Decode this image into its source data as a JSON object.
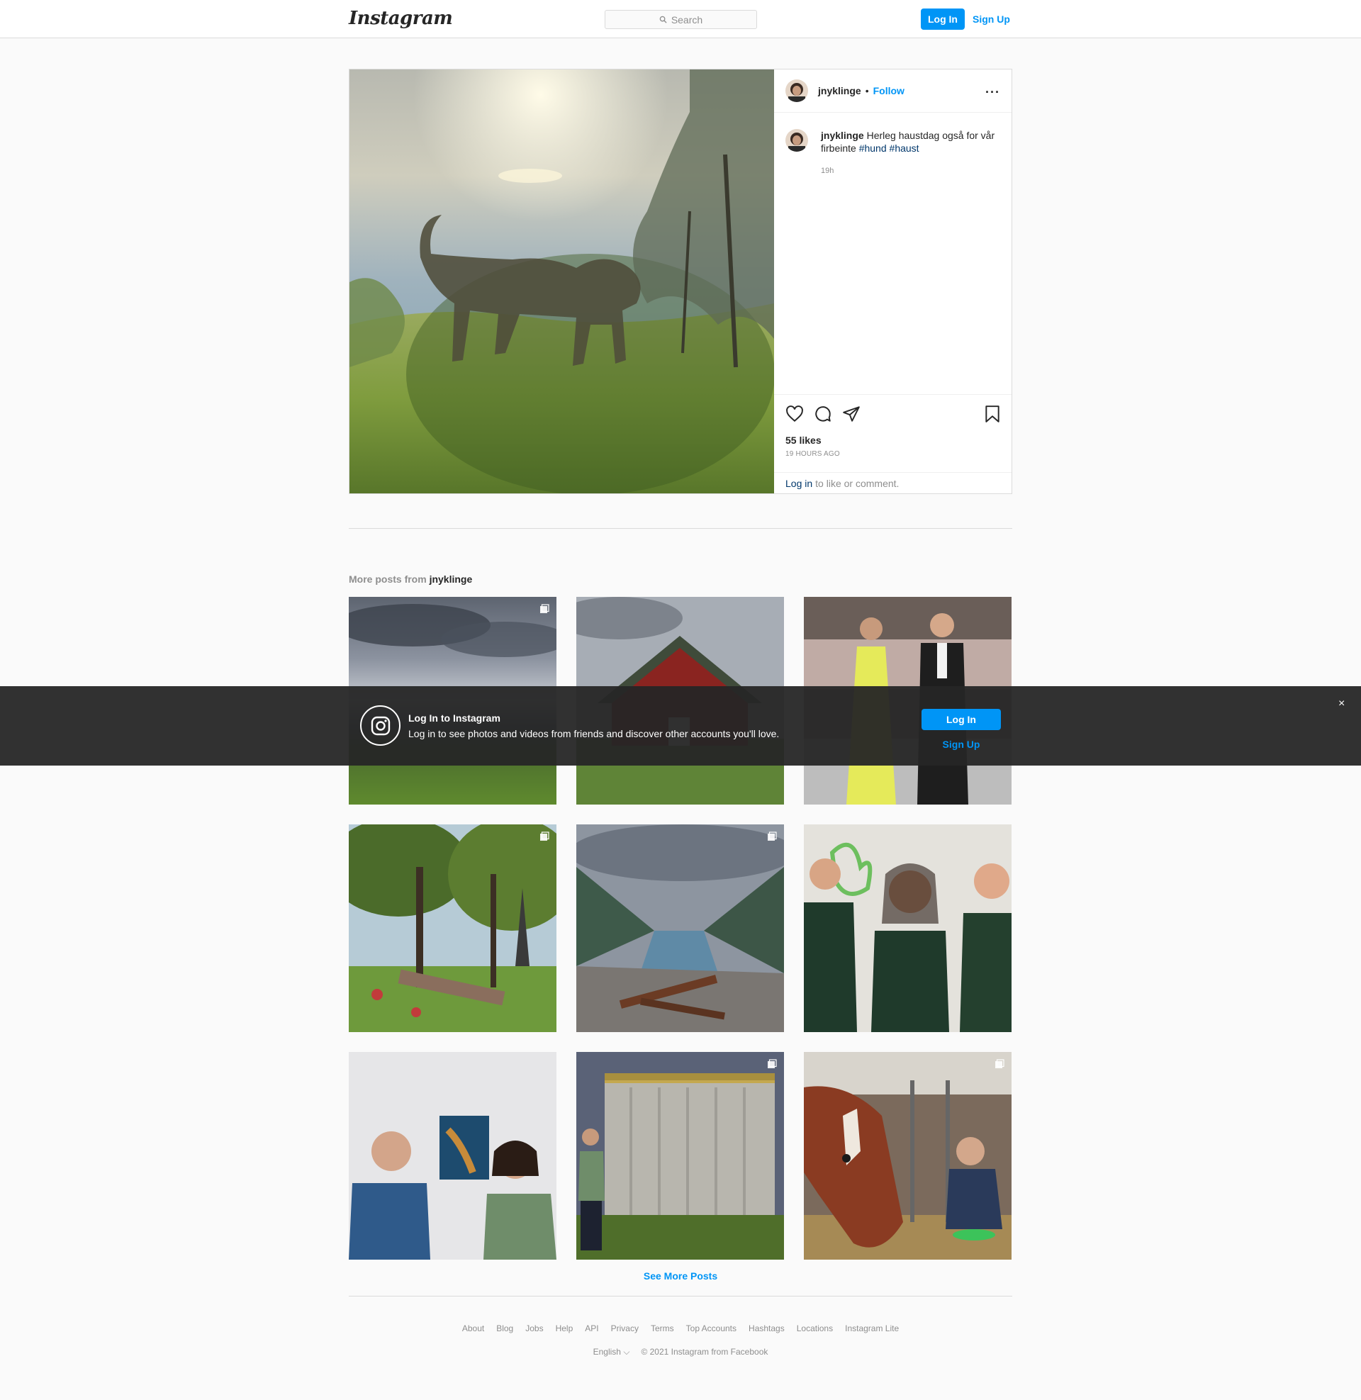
{
  "header": {
    "logo_text": "Instagram",
    "search_placeholder": "Search",
    "login_label": "Log In",
    "signup_label": "Sign Up"
  },
  "post": {
    "username": "jnyklinge",
    "separator": "•",
    "follow_label": "Follow",
    "more_label": "···",
    "caption_user": "jnyklinge",
    "caption_text": "Herleg haustdag også for vår firbeinte",
    "hashtags": [
      "#hund",
      "#haust"
    ],
    "caption_time": "19h",
    "likes": "55 likes",
    "time_ago": "19 HOURS AGO",
    "login_link": "Log in",
    "login_suffix": "to like or comment."
  },
  "more_posts": {
    "title_prefix": "More posts from",
    "title_user": "jnyklinge",
    "tiles": [
      {
        "subject": "cloudy lake landscape",
        "multi": true
      },
      {
        "subject": "red barn",
        "multi": false
      },
      {
        "subject": "couple at gala",
        "multi": false
      },
      {
        "subject": "cemetery trees",
        "multi": true
      },
      {
        "subject": "fjord view",
        "multi": true
      },
      {
        "subject": "three people in green shirts",
        "multi": false
      },
      {
        "subject": "two people with painting",
        "multi": false
      },
      {
        "subject": "silos",
        "multi": true
      },
      {
        "subject": "cows in barn",
        "multi": true
      }
    ],
    "see_more_label": "See More Posts"
  },
  "footer": {
    "links": [
      "About",
      "Blog",
      "Jobs",
      "Help",
      "API",
      "Privacy",
      "Terms",
      "Top Accounts",
      "Hashtags",
      "Locations",
      "Instagram Lite"
    ],
    "language": "English",
    "copyright": "© 2021 Instagram from Facebook"
  },
  "banner": {
    "title": "Log In to Instagram",
    "subtitle": "Log in to see photos and videos from friends and discover other accounts you'll love.",
    "login_label": "Log In",
    "signup_label": "Sign Up",
    "close_label": "×"
  },
  "colors": {
    "accent": "#0095f6",
    "link_dark": "#00376b",
    "muted": "#8e8e8e",
    "border": "#dbdbdb"
  }
}
